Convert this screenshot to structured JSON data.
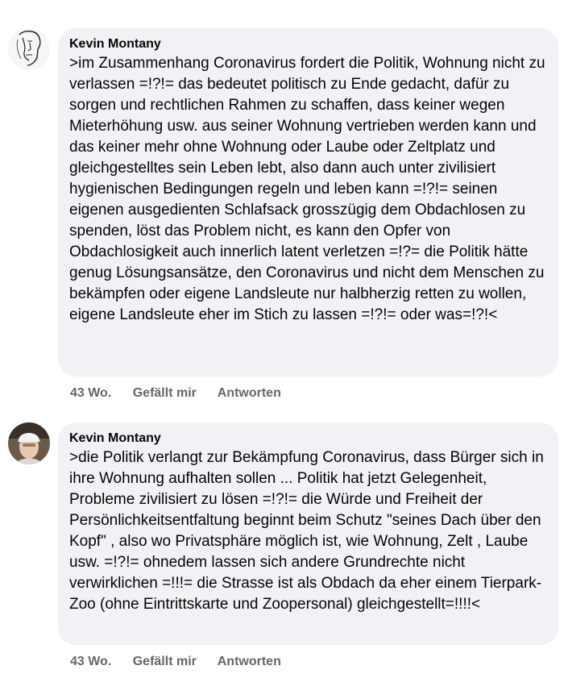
{
  "comments": [
    {
      "author": "Kevin Montany",
      "avatar_icon": "sketch-face-avatar-icon",
      "text": ">im Zusammenhang Coronavirus fordert die Politik, Wohnung nicht zu verlassen =!?!= das bedeutet politisch zu Ende gedacht, dafür zu sorgen und rechtlichen Rahmen zu schaffen, dass keiner wegen Mieterhöhung usw. aus seiner Wohnung vertrieben werden kann und das keiner mehr ohne Wohnung oder Laube oder Zeltplatz und gleichgestelltes sein Leben lebt, also dann auch unter zivilisiert hygienischen Bedingungen regeln und leben kann =!?!= seinen eigenen ausgedienten Schlafsack grosszügig dem Obdachlosen zu spenden, löst das Problem nicht, es kann den Opfer von Obdachlosigkeit auch innerlich latent verletzen =!?= die Politik hätte genug Lösungsansätze, den Coronavirus und nicht dem Menschen zu bekämpfen oder eigene Landsleute nur halbherzig retten zu wollen, eigene Landsleute eher im Stich zu lassen =!?!= oder was=!?!<",
      "time": "43 Wo.",
      "like_label": "Gefällt mir",
      "reply_label": "Antworten"
    },
    {
      "author": "Kevin Montany",
      "avatar_icon": "photo-avatar-icon",
      "text": ">die Politik verlangt zur Bekämpfung Coronavirus, dass Bürger sich in ihre Wohnung aufhalten sollen ... Politik hat jetzt Gelegenheit, Probleme zivilisiert zu lösen =!?!= die Würde und Freiheit der Persönlichkeitsentfaltung beginnt beim Schutz \"seines Dach über den Kopf\" , also wo Privatsphäre möglich ist, wie  Wohnung, Zelt , Laube usw. =!?!= ohnedem lassen sich andere Grundrechte nicht verwirklichen =!!!= die Strasse ist als Obdach da eher einem Tierpark- Zoo (ohne Eintrittskarte und Zoopersonal) gleichgestellt=!!!!<",
      "time": "43 Wo.",
      "like_label": "Gefällt mir",
      "reply_label": "Antworten"
    }
  ]
}
